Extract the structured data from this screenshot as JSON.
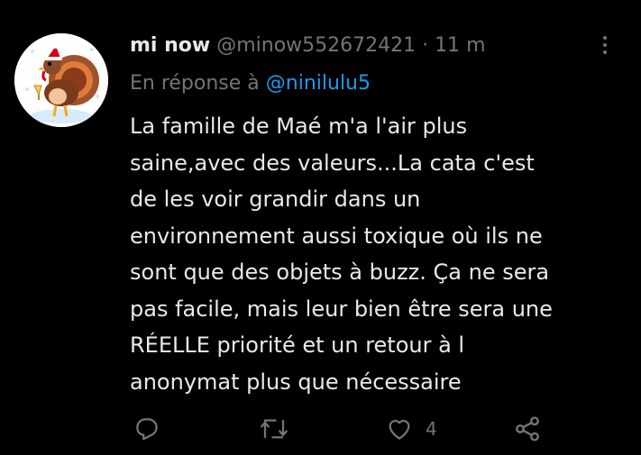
{
  "tweet": {
    "display_name": "mi now",
    "handle": "@minow552672421",
    "separator": "·",
    "time": "11 m",
    "reply_prefix": "En réponse à",
    "reply_to": "@ninilulu5",
    "text_lines": [
      "La famille de Maé m'a l'air plus",
      "saine,avec des valeurs...La cata c'est",
      "de les voir grandir dans un",
      "environnement aussi toxique où ils ne",
      "sont que des objets à buzz. Ça ne sera",
      "pas facile, mais leur bien être sera une",
      "RÉELLE priorité et un retour à l",
      "anonymat plus que nécessaire"
    ]
  },
  "actions": {
    "reply_icon": "reply-icon",
    "retweet_icon": "retweet-icon",
    "like_icon": "heart-icon",
    "like_count": "4",
    "share_icon": "share-icon"
  },
  "colors": {
    "background": "#000000",
    "text": "#e7e9ea",
    "muted": "#71767b",
    "link": "#1d9bf0"
  }
}
